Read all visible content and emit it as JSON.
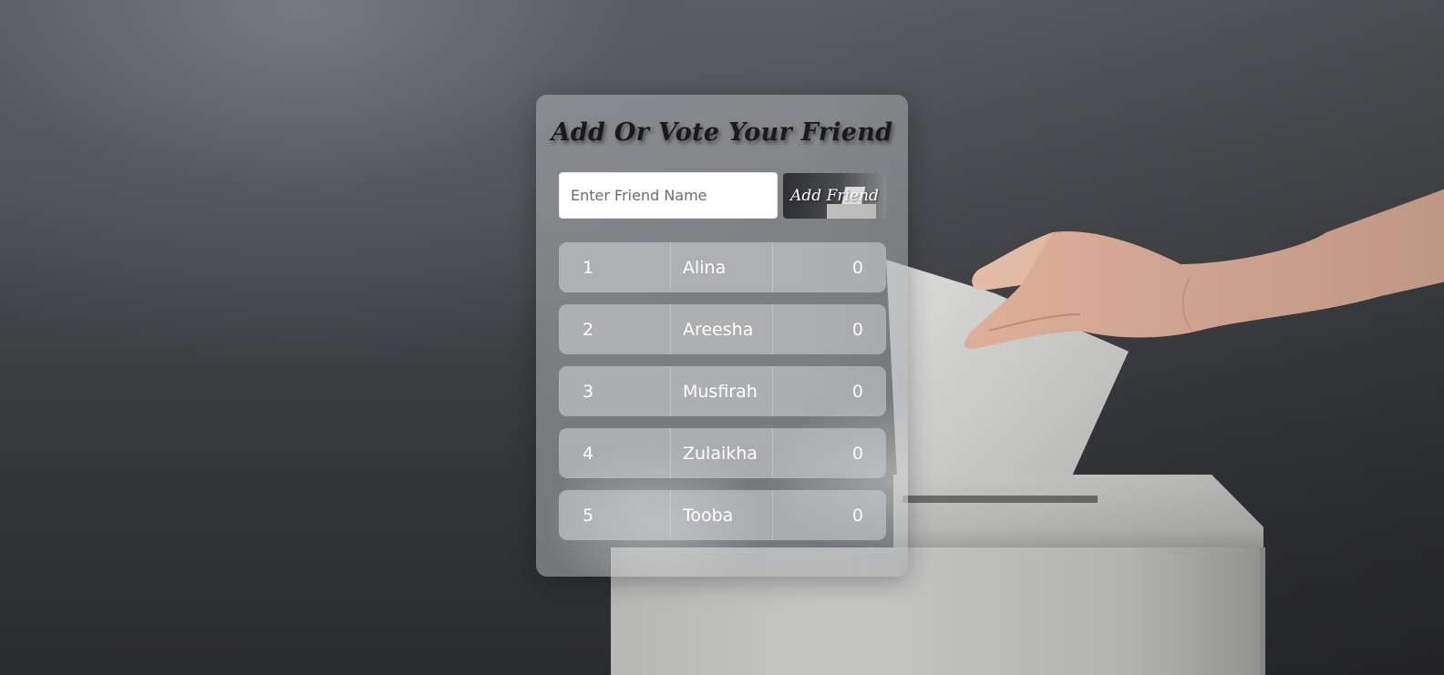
{
  "app": {
    "title": "Add Or Vote Your Friend"
  },
  "form": {
    "input_placeholder": "Enter Friend Name",
    "input_value": "",
    "add_button_label": "Add Friend"
  },
  "friends": [
    {
      "rank": "1",
      "name": "Alina",
      "votes": "0"
    },
    {
      "rank": "2",
      "name": "Areesha",
      "votes": "0"
    },
    {
      "rank": "3",
      "name": "Musfirah",
      "votes": "0"
    },
    {
      "rank": "4",
      "name": "Zulaikha",
      "votes": "0"
    },
    {
      "rank": "5",
      "name": "Tooba",
      "votes": "0"
    }
  ],
  "colors": {
    "card_glass": "#afb1b4",
    "row_glass": "#d6d7d9",
    "title_text": "#1a1a1a",
    "row_text": "#ffffff"
  }
}
